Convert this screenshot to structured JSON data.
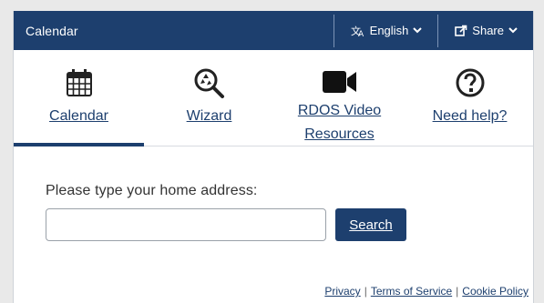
{
  "header": {
    "title": "Calendar",
    "language_label": "English",
    "share_label": "Share"
  },
  "tabs": [
    {
      "label": "Calendar",
      "icon": "calendar-icon",
      "active": true
    },
    {
      "label": "Wizard",
      "icon": "recycle-search-icon",
      "active": false
    },
    {
      "label": "RDOS Video Resources",
      "icon": "video-camera-icon",
      "active": false
    },
    {
      "label": "Need help?",
      "icon": "question-circle-icon",
      "active": false
    }
  ],
  "search": {
    "prompt": "Please type your home address:",
    "value": "",
    "placeholder": "",
    "button_label": "Search"
  },
  "footer": {
    "links": [
      "Privacy",
      "Terms of Service",
      "Cookie Policy"
    ],
    "separator": "|"
  },
  "colors": {
    "brand": "#1d3f6e",
    "background": "#e9e9e9"
  }
}
